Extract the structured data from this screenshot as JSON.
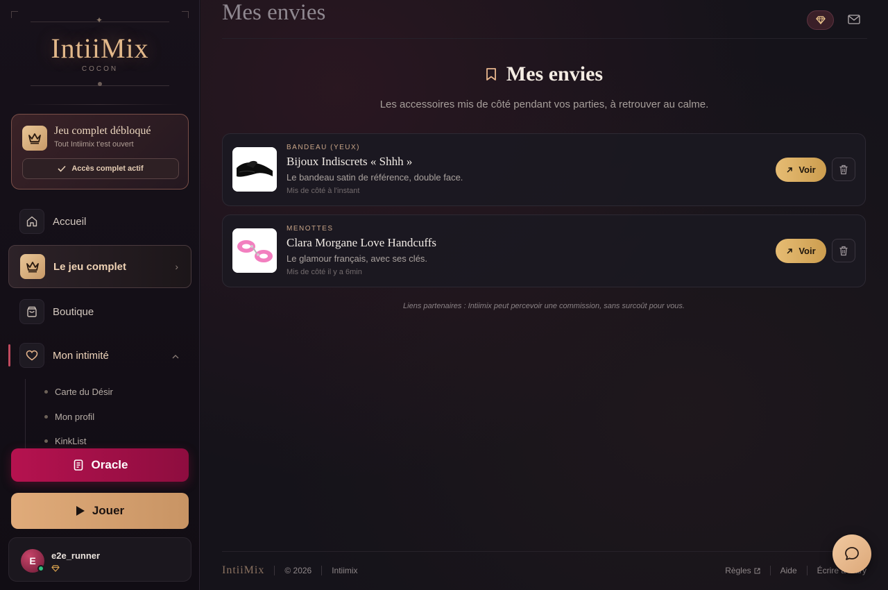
{
  "brand": {
    "logo": "IntiiMix",
    "tagline": "COCON"
  },
  "unlock": {
    "title": "Jeu complet débloqué",
    "subtitle": "Tout Intiimix t'est ouvert",
    "access_label": "Accès complet actif"
  },
  "nav": {
    "home": "Accueil",
    "full_game": "Le jeu complet",
    "shop": "Boutique",
    "intimacy": "Mon intimité",
    "sub_items": [
      "Carte du Désir",
      "Mon profil",
      "KinkList"
    ]
  },
  "actions": {
    "oracle": "Oracle",
    "play": "Jouer"
  },
  "user": {
    "initial": "E",
    "name": "e2e_runner"
  },
  "topbar": {
    "title": "Mes envies"
  },
  "page": {
    "heading": "Mes envies",
    "description": "Les accessoires mis de côté pendant vos parties, à retrouver au calme."
  },
  "wishlist": [
    {
      "category": "BANDEAU (YEUX)",
      "name": "Bijoux Indiscrets « Shhh »",
      "description": "Le bandeau satin de référence, double face.",
      "saved": "Mis de côté à l'instant",
      "view_label": "Voir"
    },
    {
      "category": "MENOTTES",
      "name": "Clara Morgane Love Handcuffs",
      "description": "Le glamour français, avec ses clés.",
      "saved": "Mis de côté il y a 6min",
      "view_label": "Voir"
    }
  ],
  "affiliate_note": "Liens partenaires : Intiimix peut percevoir une commission, sans surcoût pour vous.",
  "footer": {
    "logo": "IntiiMix",
    "copyright": "© 2026",
    "brand": "Intiimix",
    "rules": "Règles",
    "help": "Aide",
    "contact": "Écrire à Mary"
  },
  "colors": {
    "accent_gold": "#e2b88a",
    "oracle": "#b5124f",
    "play": "#e0ab7a",
    "voir": "#e6bc73",
    "background": "#15131a"
  }
}
